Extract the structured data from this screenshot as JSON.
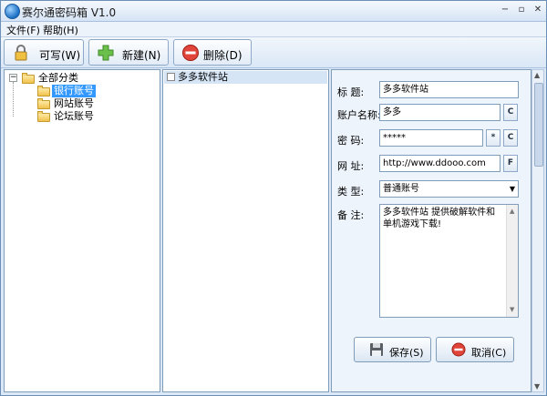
{
  "window": {
    "title": "赛尔通密码箱 V1.0",
    "controls": {
      "minimize": "−",
      "restore": "▫",
      "close": "✕"
    }
  },
  "menu": {
    "file": "文件(F)",
    "help": "帮助(H)"
  },
  "toolbar": {
    "writable": "可写(W)",
    "new": "新建(N)",
    "delete": "删除(D)"
  },
  "tree": {
    "root": "全部分类",
    "children": [
      "银行账号",
      "网站账号",
      "论坛账号"
    ],
    "selected_index": 0
  },
  "list": {
    "items": [
      "多多软件站"
    ]
  },
  "form": {
    "title_label": "标  题:",
    "title_value": "多多软件站",
    "account_label": "账户名称:",
    "account_value": "多多",
    "password_label": "密  码:",
    "password_value": "*****",
    "url_label": "网  址:",
    "url_value": "http://www.ddooo.com",
    "type_label": "类  型:",
    "type_value": "普通账号",
    "note_label": "备  注:",
    "note_value": "多多软件站 提供破解软件和单机游戏下载!",
    "copy_btn": "C",
    "star_btn": "*",
    "go_btn": "F",
    "save": "保存(S)",
    "cancel": "取消(C)"
  },
  "colors": {
    "selected_row": "#3399ff",
    "accent": "#6c8fb8"
  }
}
